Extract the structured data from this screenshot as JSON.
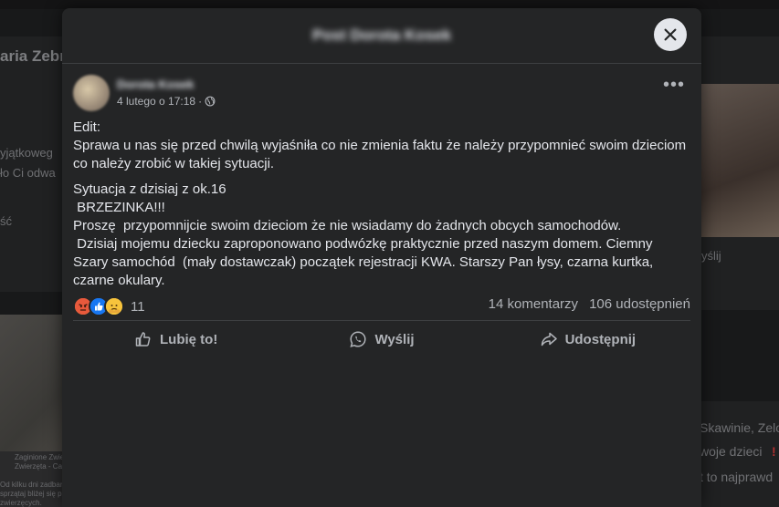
{
  "background": {
    "left": {
      "title": "aria Zebr",
      "line1": "yjątkoweg",
      "line2": "ło Ci odwa",
      "line3": "ść",
      "caption1": "Zaginione Zwie",
      "caption2": "Zwierzęta - Cal",
      "caption3": "Od kilku dni zadbany",
      "caption4": "sprzątaj bliżej się pe",
      "caption5": "zwierzęcych."
    },
    "right": {
      "share_fragment": "yślij",
      "line1": "Skawinie, Zelo",
      "line2": "woje dzieci",
      "line3": "t to najprawd",
      "alert": "!"
    }
  },
  "modal": {
    "title": "Post Dorota Kosek",
    "close_label": "✕"
  },
  "post": {
    "author": "Dorota Kosek",
    "date": "4 lutego o 17:18",
    "separator": "·",
    "more": "•••",
    "paragraphs": [
      "Edit:\nSprawa u nas się przed chwilą wyjaśniła co nie zmienia faktu że należy przypomnieć swoim dzieciom co należy zrobić w takiej sytuacji.",
      "Sytuacja z dzisiaj z ok.16\n BRZEZINKA!!!\nProszę  przypomnijcie swoim dzieciom że nie wsiadamy do żadnych obcych samochodów.\n Dzisiaj mojemu dziecku zaproponowano podwózkę praktycznie przed naszym domem. Ciemny Szary samochód  (mały dostawczak) początek rejestracji KWA. Starszy Pan łysy, czarna kurtka,  czarne okulary."
    ],
    "reaction_count": "11",
    "comments": "14 komentarzy",
    "shares": "106 udostępnień"
  },
  "actions": {
    "like": "Lubię to!",
    "send": "Wyślij",
    "share": "Udostępnij"
  },
  "colors": {
    "modal_bg": "#242526",
    "text": "#e4e6eb",
    "secondary": "#b0b3b8",
    "like_blue": "#1877f2"
  }
}
